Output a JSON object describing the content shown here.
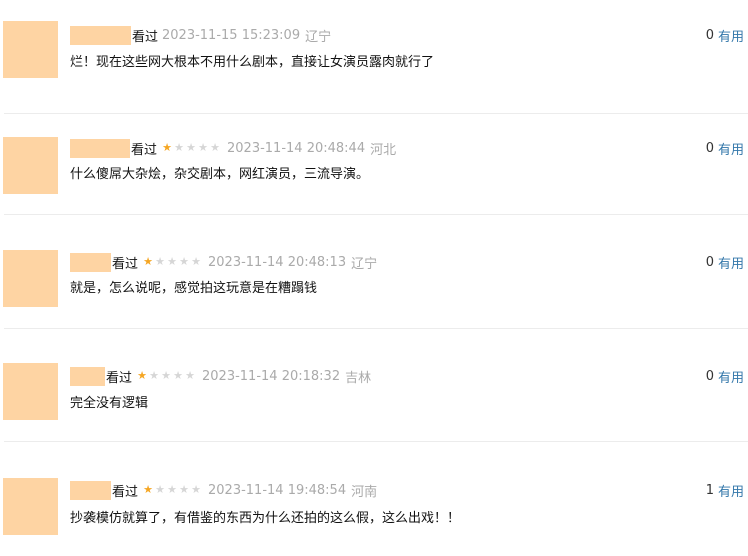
{
  "comments": [
    {
      "watched_label": "看过",
      "stars": 0,
      "time": "2023-11-15 15:23:09",
      "location": "辽宁",
      "content": "烂！现在这些网大根本不用什么剧本，直接让女演员露肉就行了",
      "votes": "0",
      "useful_label": "有用"
    },
    {
      "watched_label": "看过",
      "stars": 1,
      "time": "2023-11-14 20:48:44",
      "location": "河北",
      "content": "什么傻屌大杂烩，杂交剧本，网红演员，三流导演。",
      "votes": "0",
      "useful_label": "有用"
    },
    {
      "watched_label": "看过",
      "stars": 1,
      "time": "2023-11-14 20:48:13",
      "location": "辽宁",
      "content": "就是，怎么说呢，感觉拍这玩意是在糟蹋钱",
      "votes": "0",
      "useful_label": "有用"
    },
    {
      "watched_label": "看过",
      "stars": 1,
      "time": "2023-11-14 20:18:32",
      "location": "吉林",
      "content": "完全没有逻辑",
      "votes": "0",
      "useful_label": "有用"
    },
    {
      "watched_label": "看过",
      "stars": 1,
      "time": "2023-11-14 19:48:54",
      "location": "河南",
      "content": "抄袭模仿就算了，有借鉴的东西为什么还拍的这么假，这么出戏！！",
      "votes": "1",
      "useful_label": "有用"
    }
  ],
  "colors": {
    "avatar_placeholder": "#fed4a3",
    "star_on": "#f5a623",
    "star_off": "#d6d6d6",
    "meta_gray": "#aaaaaa",
    "link_blue": "#3377aa"
  },
  "icons": {
    "star": "star-icon"
  }
}
